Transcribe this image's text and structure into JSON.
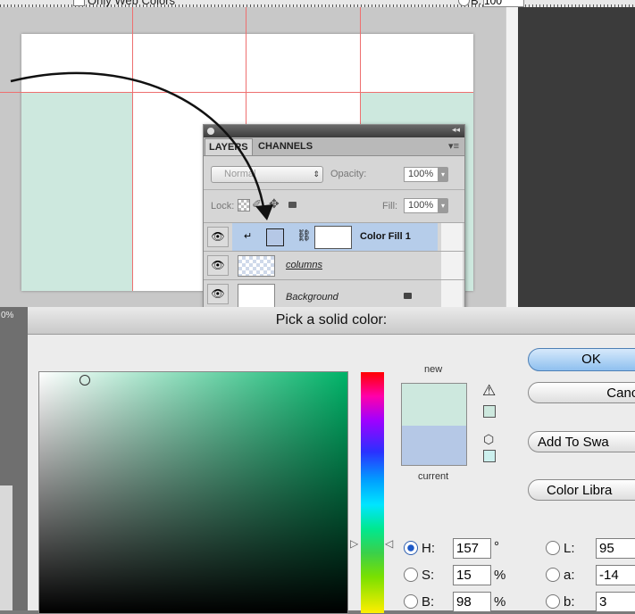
{
  "toolbar": {
    "web_colors_label": "Only Web Colors",
    "b_label": "B:",
    "b_value": "100"
  },
  "layers_panel": {
    "tabs": [
      {
        "label": "LAYERS"
      },
      {
        "label": "CHANNELS"
      }
    ],
    "blend_mode": "Normal",
    "opacity_label": "Opacity:",
    "opacity_value": "100%",
    "lock_label": "Lock:",
    "fill_label": "Fill:",
    "fill_value": "100%",
    "layers": [
      {
        "name": "Color Fill 1",
        "selected": true
      },
      {
        "name": "columns",
        "selected": false
      },
      {
        "name": "Background",
        "selected": false
      }
    ]
  },
  "zoom_label": "0%",
  "picker": {
    "title": "Pick a solid color:",
    "new_label": "new",
    "current_label": "current",
    "buttons": {
      "ok": "OK",
      "cancel": "Cancel",
      "add_swatches": "Add To Swa",
      "color_libraries": "Color Libra"
    },
    "new_color": "#cde8de",
    "current_color": "#b5c8e6",
    "fields": {
      "h": {
        "label": "H:",
        "value": "157",
        "unit": "°"
      },
      "s": {
        "label": "S:",
        "value": "15",
        "unit": "%"
      },
      "b": {
        "label": "B:",
        "value": "98",
        "unit": "%"
      },
      "l": {
        "label": "L:",
        "value": "95"
      },
      "a": {
        "label": "a:",
        "value": "-14"
      },
      "lab_b": {
        "label": "b:",
        "value": "3"
      }
    }
  },
  "colors": {
    "guide": "#ee6f6f",
    "mint": "#cde8de",
    "selected_row": "#b6cdea"
  }
}
